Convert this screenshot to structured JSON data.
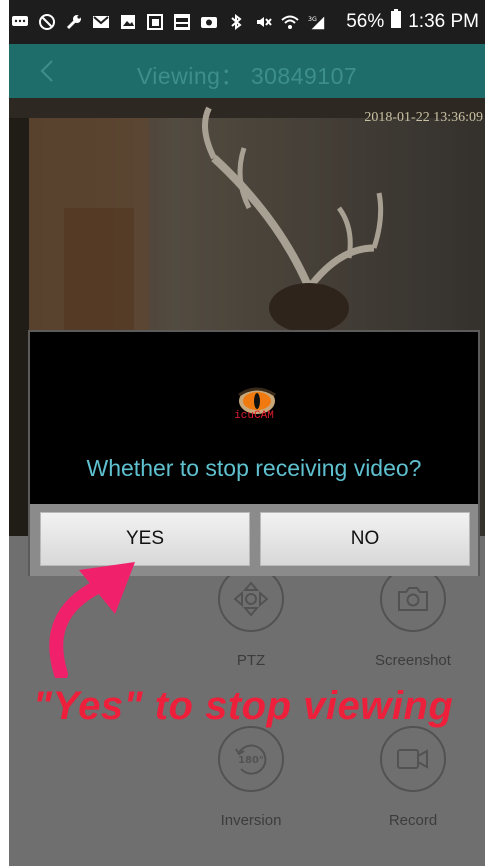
{
  "status_bar": {
    "icons": [
      "message-icon",
      "block-icon",
      "wrench-icon",
      "gmail-icon",
      "image-icon",
      "screenshot-icon",
      "fox-news-icon",
      "camera-icon",
      "bluetooth-icon",
      "mute-icon",
      "wifi-icon",
      "signal-3g-icon"
    ],
    "battery": "56%",
    "time": "1:36 PM"
  },
  "header": {
    "back_icon": "chevron-left-icon",
    "title": "Viewing： 30849107"
  },
  "video": {
    "timestamp": "2018-01-22 13:36:09"
  },
  "controls": [
    {
      "icon": "ptz-icon",
      "label": "PTZ"
    },
    {
      "icon": "camera-icon",
      "label": "Screenshot"
    },
    {
      "icon": "rotate-180-icon",
      "icon_text": "180°",
      "label": "Inversion"
    },
    {
      "icon": "video-record-icon",
      "label": "Record"
    }
  ],
  "dialog": {
    "logo_text": "icuCAM",
    "message": "Whether to stop receiving video?",
    "yes_label": "YES",
    "no_label": "NO"
  },
  "annotation": {
    "text": "\"Yes\" to stop viewing",
    "color": "#ee1f3a"
  },
  "colors": {
    "header_bg": "#1f6d6a",
    "header_title": "#3d8f8b",
    "dialog_message": "#5fc0cf",
    "controls_bg": "#8f8f8f"
  }
}
